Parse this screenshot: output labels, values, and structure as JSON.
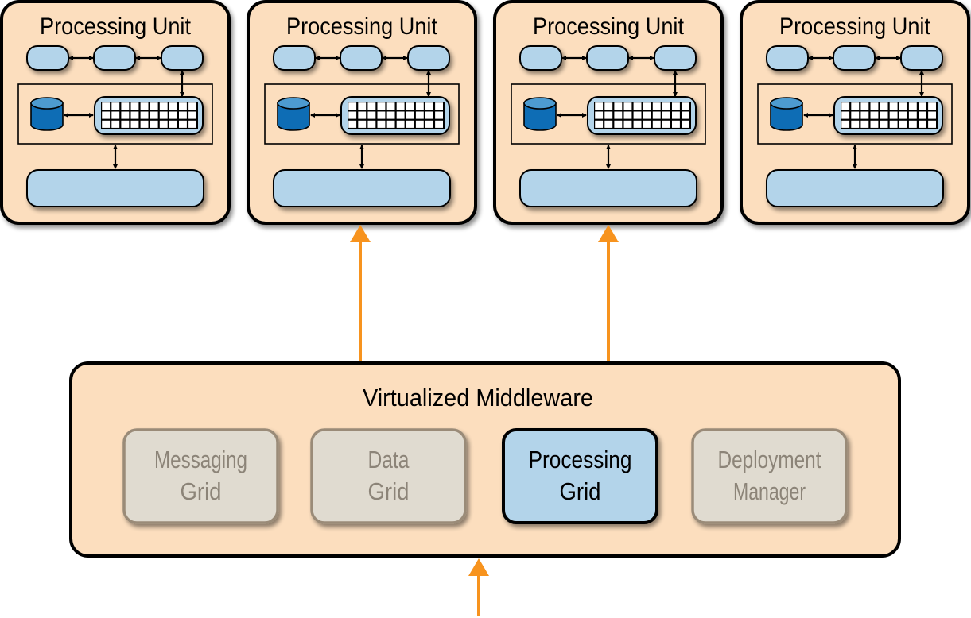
{
  "colors": {
    "peach": "#fcdebe",
    "light_blue": "#b3d4ea",
    "db_blue": "#0e6db5",
    "db_top": "#4d9bd0",
    "orange": "#f7931e",
    "gray_fill": "#e0dbd0",
    "gray_stroke": "#9a8b78",
    "gray_text": "#8c8478",
    "black": "#000000"
  },
  "processing_units": [
    {
      "title": "Processing Unit"
    },
    {
      "title": "Processing Unit"
    },
    {
      "title": "Processing Unit"
    },
    {
      "title": "Processing Unit"
    }
  ],
  "unit_grid": {
    "rows": 3,
    "cols": 10
  },
  "middleware": {
    "title": "Virtualized Middleware",
    "components": [
      {
        "line1": "Messaging",
        "line2": "Grid",
        "active": false
      },
      {
        "line1": "Data",
        "line2": "Grid",
        "active": false
      },
      {
        "line1": "Processing",
        "line2": "Grid",
        "active": true
      },
      {
        "line1": "Deployment",
        "line2": "Manager",
        "active": false
      }
    ]
  },
  "connections": [
    {
      "from": "processing-grid",
      "to": "processing-unit-2"
    },
    {
      "from": "processing-grid",
      "to": "processing-unit-3"
    },
    {
      "from": "external-input",
      "to": "virtualized-middleware"
    }
  ]
}
